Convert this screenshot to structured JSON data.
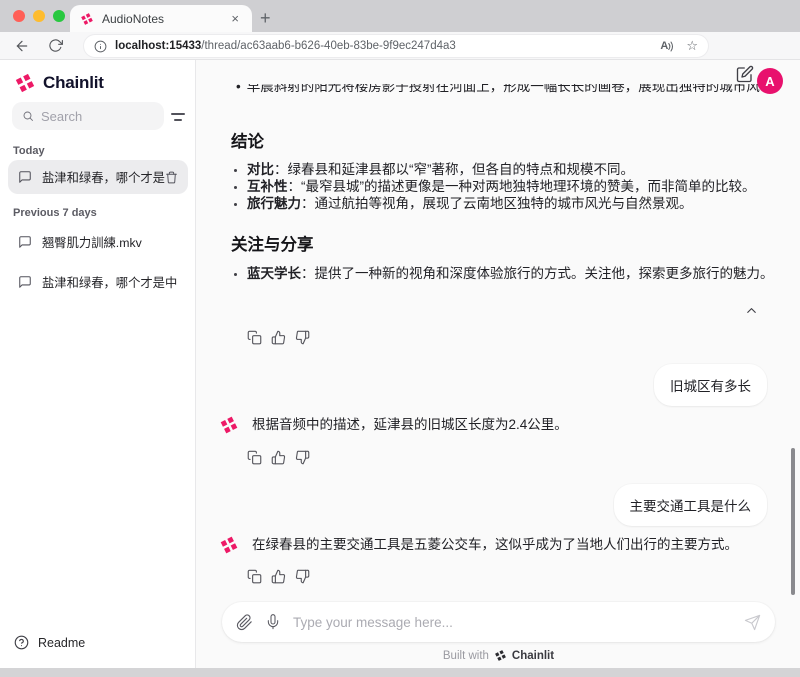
{
  "colors": {
    "accent_pink": "#E8116D",
    "brand_navy": "#12122B",
    "main_bg": "#FAFAFA"
  },
  "browser": {
    "tab_title": "AudioNotes",
    "close_glyph": "×",
    "new_tab_glyph": "+",
    "url_host": "localhost:15433",
    "url_path": "/thread/ac63aab6-b626-40eb-83be-9f9ec247d4a3",
    "read_aloud_glyph": "A",
    "star_glyph": "☆",
    "menu_dots_glyph": "···"
  },
  "sidebar": {
    "brand": "Chainlit",
    "search_placeholder": "Search",
    "section_today": "Today",
    "section_previous": "Previous 7 days",
    "today_item": "盐津和绿春，哪个才是中...",
    "prev_items": [
      "翘臀肌力訓練.mkv",
      "盐津和绿春，哪个才是中国..."
    ],
    "readme": "Readme"
  },
  "app_header": {
    "avatar_letter": "A"
  },
  "chat": {
    "clipped_line": "早晨斜射的阳光将楼房影子投射在河面上，形成一幅长长的画卷，展现出独特的城市风光。",
    "conclusion": {
      "heading": "结论",
      "bullets": [
        {
          "term": "对比",
          "rest": "：绿春县和延津县都以“窄”著称，但各自的特点和规模不同。"
        },
        {
          "term": "互补性",
          "rest": "：“最窄县城”的描述更像是一种对两地独特地理环境的赞美，而非简单的比较。"
        },
        {
          "term": "旅行魅力",
          "rest": "：通过航拍等视角，展现了云南地区独特的城市风光与自然景观。"
        }
      ]
    },
    "share": {
      "heading": "关注与分享",
      "bullets": [
        {
          "term": "蓝天学长",
          "rest": "：提供了一种新的视角和深度体验旅行的方式。关注他，探索更多旅行的魅力。"
        }
      ]
    },
    "messages": {
      "user1": "旧城区有多长",
      "assistant1": "根据音频中的描述，延津县的旧城区长度为2.4公里。",
      "user2": "主要交通工具是什么",
      "assistant2": "在绿春县的主要交通工具是五菱公交车，这似乎成为了当地人们出行的主要方式。"
    }
  },
  "composer": {
    "placeholder": "Type your message here...",
    "footer_prefix": "Built with",
    "footer_brand": "Chainlit"
  }
}
